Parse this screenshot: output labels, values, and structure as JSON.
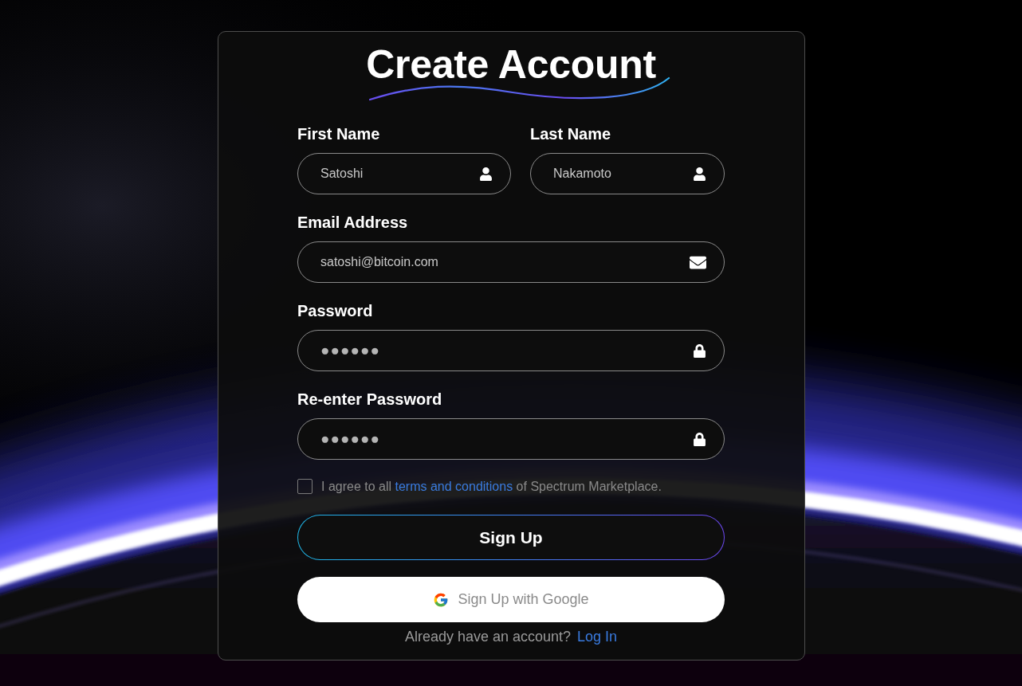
{
  "title": "Create Account",
  "rows": [
    {
      "fields": [
        {
          "kind": "name",
          "label": "First Name",
          "value": "Satoshi"
        },
        {
          "kind": "name",
          "label": "Last Name",
          "value": "Nakamoto"
        }
      ]
    },
    {
      "fields": [
        {
          "kind": "email",
          "label": "Email Address",
          "value": "satoshi@bitcoin.com"
        }
      ]
    },
    {
      "fields": [
        {
          "kind": "password",
          "label": "Password",
          "value": "●●●●●●"
        }
      ]
    },
    {
      "fields": [
        {
          "kind": "password",
          "label": "Re-enter Password",
          "value": "●●●●●●"
        }
      ]
    }
  ],
  "agreement": {
    "checked": false,
    "text_before": "I agree to all",
    "link": "terms and conditions",
    "text_after": "of Spectrum Marketplace."
  },
  "buttons": [
    {
      "kind": "primary",
      "label": "Sign Up"
    },
    {
      "kind": "google",
      "label": "Sign Up with Google"
    }
  ],
  "footer": {
    "prompt": "Already have an account?",
    "link": "Log In"
  }
}
